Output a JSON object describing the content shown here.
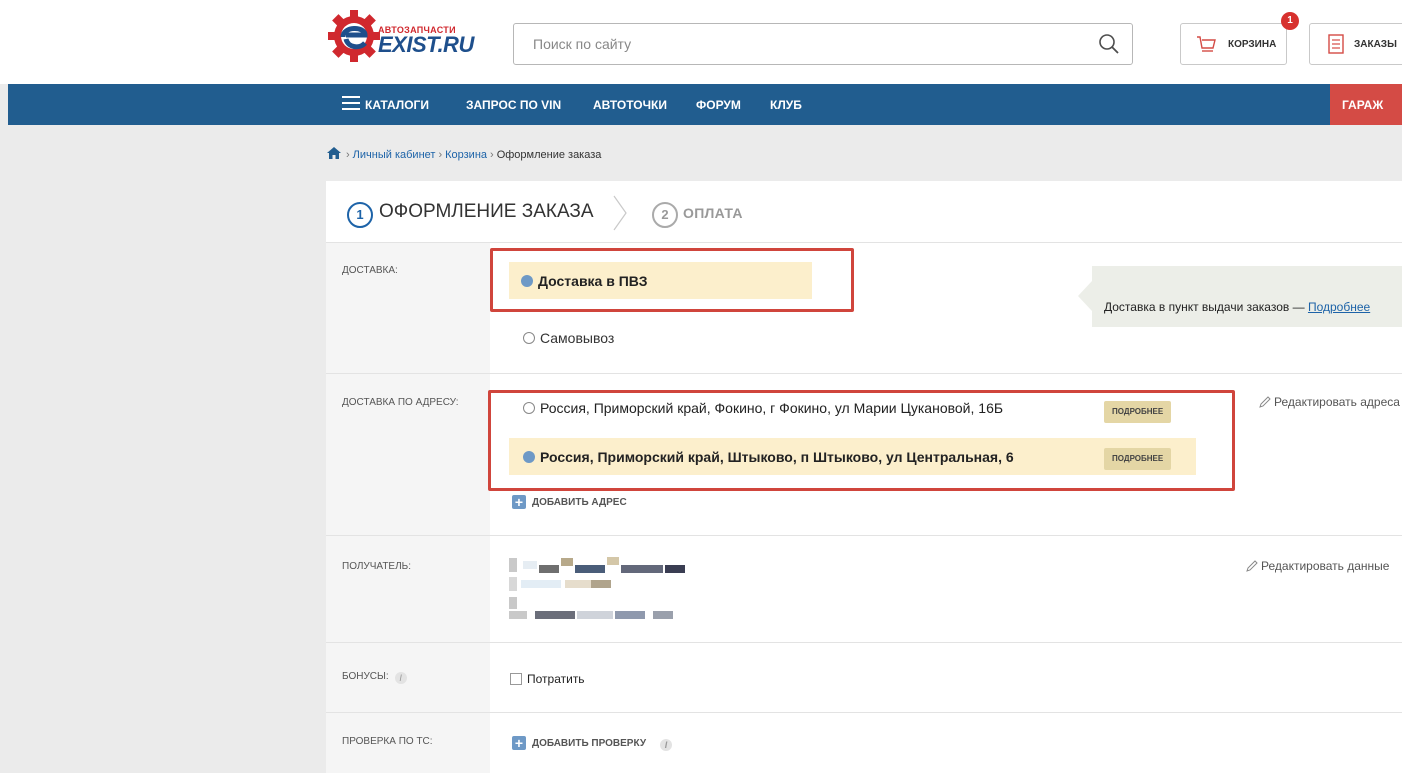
{
  "header": {
    "logo_small": "АВТОЗАПЧАСТИ",
    "logo_brand": "EXIST.RU",
    "search_placeholder": "Поиск по сайту",
    "cart_label": "КОРЗИНА",
    "cart_count": "1",
    "orders_label": "ЗАКАЗЫ"
  },
  "nav": {
    "items": [
      "КАТАЛОГИ",
      "ЗАПРОС ПО VIN",
      "АВТОТОЧКИ",
      "ФОРУМ",
      "КЛУБ"
    ],
    "garage_label": "ГАРАЖ"
  },
  "breadcrumb": {
    "items": [
      "Личный кабинет",
      "Корзина"
    ],
    "current": "Оформление заказа"
  },
  "steps": [
    {
      "num": "1",
      "label": "ОФОРМЛЕНИЕ ЗАКАЗА"
    },
    {
      "num": "2",
      "label": "ОПЛАТА"
    }
  ],
  "delivery": {
    "label": "ДОСТАВКА:",
    "options": [
      "Доставка в ПВЗ",
      "Самовывоз"
    ],
    "hint_text": "Доставка в пункт выдачи заказов —",
    "hint_link": "Подробнее"
  },
  "address": {
    "label": "ДОСТАВКА ПО АДРЕСУ:",
    "options": [
      "Россия, Приморский край, Фокино, г Фокино, ул Марии Цукановой, 16Б",
      "Россия, Приморский край, Штыково, п Штыково, ул Центральная, 6"
    ],
    "more_label": "ПОДРОБНЕЕ",
    "edit_label": "Редактировать адреса",
    "add_label": "ДОБАВИТЬ АДРЕС"
  },
  "recipient": {
    "label": "ПОЛУЧАТЕЛЬ:",
    "edit_label": "Редактировать данные"
  },
  "bonus": {
    "label": "БОНУСЫ:",
    "spend_label": "Потратить"
  },
  "check": {
    "label": "ПРОВЕРКА ПО ТС:",
    "add_label": "ДОБАВИТЬ ПРОВЕРКУ"
  },
  "colors": {
    "nav_blue": "#215d8f",
    "garage_red": "#d44b45",
    "selected_bg": "#fcefcc",
    "highlight_frame": "#d0453c",
    "link_blue": "#1d63a8"
  }
}
